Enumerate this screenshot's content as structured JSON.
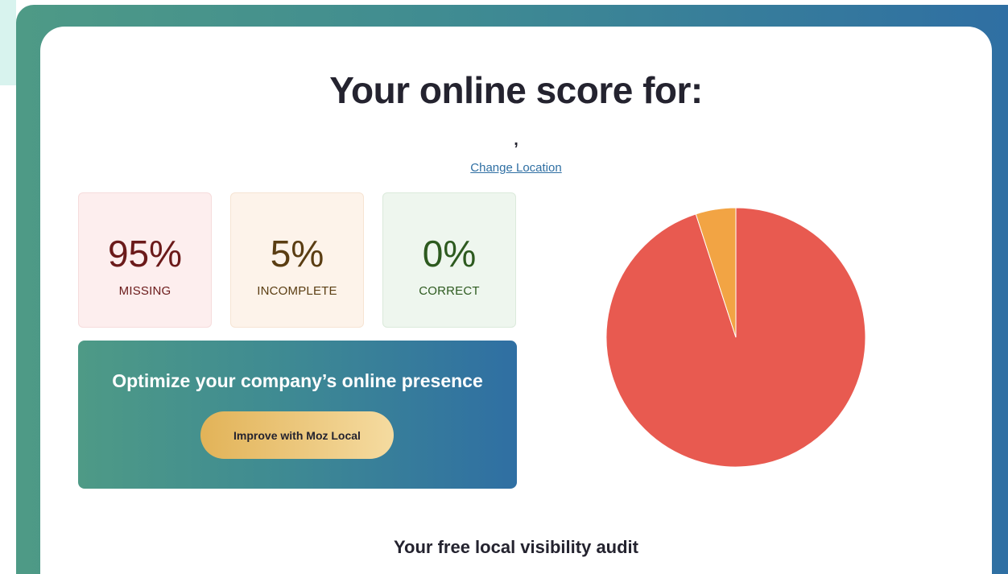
{
  "header": {
    "title": "Your online score for:",
    "location": ",",
    "change_location_label": "Change Location"
  },
  "stats": [
    {
      "value": "95%",
      "label": "MISSING"
    },
    {
      "value": "5%",
      "label": "INCOMPLETE"
    },
    {
      "value": "0%",
      "label": "CORRECT"
    }
  ],
  "promo": {
    "heading": "Optimize your company’s online presence",
    "button_label": "Improve with Moz Local"
  },
  "chart_data": {
    "type": "pie",
    "categories": [
      "Missing",
      "Incomplete",
      "Correct"
    ],
    "values": [
      95,
      5,
      0
    ],
    "colors": [
      "#e85a50",
      "#f2a444",
      "#7cb36a"
    ]
  },
  "audit": {
    "title": "Your free local visibility audit"
  }
}
